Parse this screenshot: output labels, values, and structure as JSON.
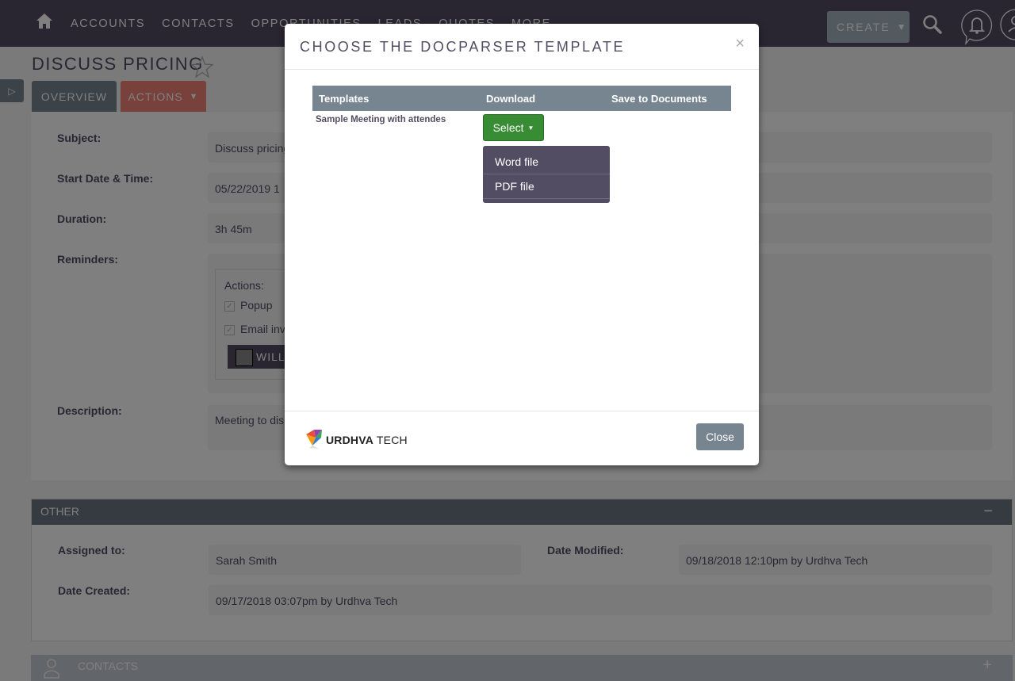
{
  "nav": {
    "home_icon": "home-icon",
    "items": [
      "ACCOUNTS",
      "CONTACTS",
      "OPPORTUNITIES",
      "LEADS",
      "QUOTES",
      "MORE"
    ],
    "create_label": "CREATE",
    "create_caret": "▼",
    "search_icon": "search-icon",
    "notifications_icon": "bell-icon",
    "user_icon": "user-icon"
  },
  "record": {
    "title": "DISCUSS PRICING",
    "sidebar_toggle": "▷",
    "tabs": [
      {
        "label": "OVERVIEW"
      },
      {
        "label": "ACTIONS",
        "caret": "▼"
      }
    ],
    "fields": {
      "subject_label": "Subject:",
      "subject_value": "Discuss pricing",
      "start_label": "Start Date & Time:",
      "start_value": "05/22/2019 1",
      "duration_label": "Duration:",
      "duration_value": "3h 45m",
      "reminders_label": "Reminders:",
      "reminders": {
        "actions_label": "Actions:",
        "popup_label": "Popup",
        "popup_checked": true,
        "email_label": "Email inv",
        "email_checked": true,
        "button_label": "WILL"
      },
      "description_label": "Description:",
      "description_value": "Meeting to dis... ystem and pricing terms and conditions as per our last meetin"
    }
  },
  "other_panel": {
    "title": "OTHER",
    "collapse": "−",
    "assigned_label": "Assigned to:",
    "assigned_value": "Sarah Smith",
    "modified_label": "Date Modified:",
    "modified_value": "09/18/2018 12:10pm by Urdhva Tech",
    "created_label": "Date Created:",
    "created_value": "09/17/2018 03:07pm by Urdhva Tech"
  },
  "contacts_panel": {
    "title": "CONTACTS",
    "expand": "+"
  },
  "modal": {
    "title": "CHOOSE THE DOCPARSER TEMPLATE",
    "close_x": "×",
    "columns": [
      "Templates",
      "Download",
      "Save to Documents"
    ],
    "rows": [
      {
        "template": "Sample Meeting with attendes",
        "download_button": "Select"
      }
    ],
    "dropdown_options": [
      "Word file",
      "PDF file"
    ],
    "logo_bold": "URDHVA",
    "logo_light": " TECH",
    "close_label": "Close"
  },
  "colors": {
    "nav_bg": "#534d64",
    "create_bg": "#a5b5c0",
    "table_header": "#778591",
    "select_green": "#378c34",
    "dropdown_bg": "#534d64",
    "actions_tab": "#f08377"
  }
}
